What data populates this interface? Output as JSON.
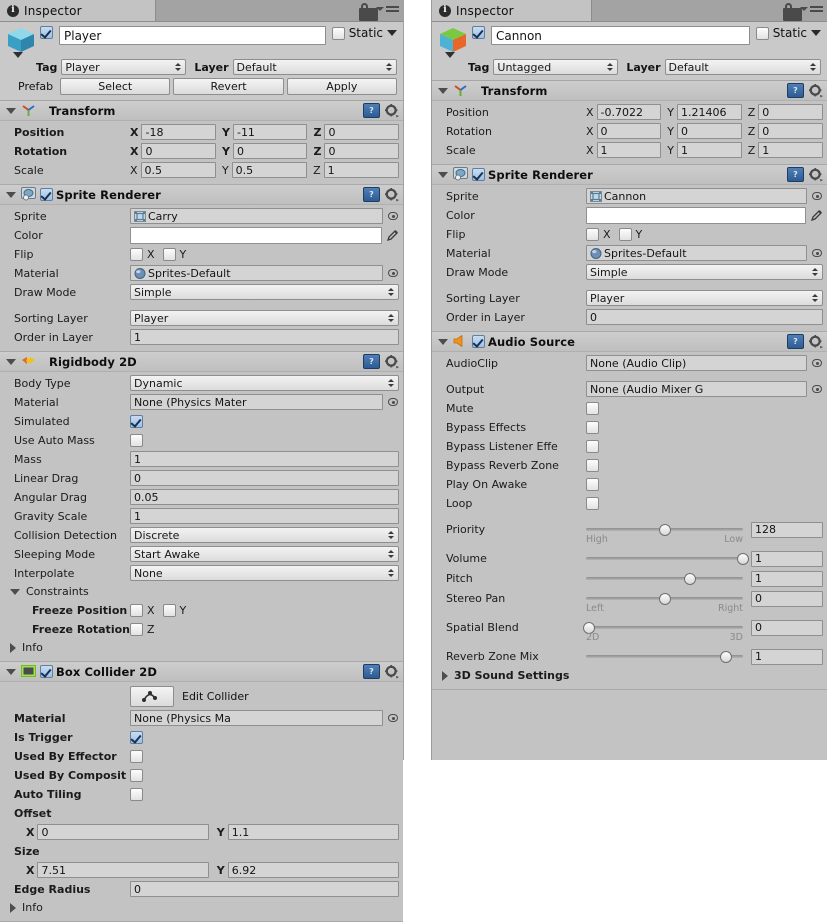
{
  "window": {
    "tab_label": "Inspector",
    "tab_icon": "info-icon",
    "lock_icon": "lock-icon",
    "menu_icon": "hamburger-menu-icon"
  },
  "left": {
    "header": {
      "enabled": true,
      "name": "Player",
      "static_label": "Static",
      "static_checked": false,
      "tag_label": "Tag",
      "tag_value": "Player",
      "layer_label": "Layer",
      "layer_value": "Default",
      "prefab_label": "Prefab",
      "prefab_buttons": [
        "Select",
        "Revert",
        "Apply"
      ]
    },
    "components": [
      {
        "title": "Transform",
        "icon": "transform-axis-icon",
        "has_checkbox": false,
        "expanded": true,
        "rows": [
          {
            "type": "vector3",
            "label": "Position",
            "bold": true,
            "x": "-18",
            "y": "-11",
            "z": "0"
          },
          {
            "type": "vector3",
            "label": "Rotation",
            "bold": true,
            "x": "0",
            "y": "0",
            "z": "0"
          },
          {
            "type": "vector3",
            "label": "Scale",
            "bold": false,
            "x": "0.5",
            "y": "0.5",
            "z": "1"
          }
        ]
      },
      {
        "title": "Sprite Renderer",
        "icon": "sprite-renderer-icon",
        "has_checkbox": true,
        "checked": true,
        "expanded": true,
        "rows": [
          {
            "type": "object",
            "label": "Sprite",
            "value": "Carry",
            "thumb": "sprite-thumb"
          },
          {
            "type": "color",
            "label": "Color",
            "value": "#ffffff"
          },
          {
            "type": "flip",
            "label": "Flip",
            "x_label": "X",
            "y_label": "Y",
            "x": false,
            "y": false
          },
          {
            "type": "object",
            "label": "Material",
            "value": "Sprites-Default",
            "thumb": "material-sphere"
          },
          {
            "type": "popup",
            "label": "Draw Mode",
            "value": "Simple"
          },
          {
            "type": "spacer"
          },
          {
            "type": "popup",
            "label": "Sorting Layer",
            "value": "Player"
          },
          {
            "type": "text",
            "label": "Order in Layer",
            "value": "1"
          }
        ]
      },
      {
        "title": "Rigidbody 2D",
        "icon": "rigidbody2d-icon",
        "has_checkbox": false,
        "expanded": true,
        "rows": [
          {
            "type": "popup",
            "label": "Body Type",
            "value": "Dynamic"
          },
          {
            "type": "object",
            "label": "Material",
            "value": "None (Physics Mater",
            "thumb": "none"
          },
          {
            "type": "check",
            "label": "Simulated",
            "checked": true
          },
          {
            "type": "check",
            "label": "Use Auto Mass",
            "checked": false
          },
          {
            "type": "text",
            "label": "Mass",
            "value": "1"
          },
          {
            "type": "text",
            "label": "Linear Drag",
            "value": "0"
          },
          {
            "type": "text",
            "label": "Angular Drag",
            "value": "0.05"
          },
          {
            "type": "text",
            "label": "Gravity Scale",
            "value": "1"
          },
          {
            "type": "popup",
            "label": "Collision Detection",
            "value": "Discrete"
          },
          {
            "type": "popup",
            "label": "Sleeping Mode",
            "value": "Start Awake"
          },
          {
            "type": "popup",
            "label": "Interpolate",
            "value": "None"
          },
          {
            "type": "foldout",
            "label": "Constraints",
            "open": true
          },
          {
            "type": "freeze",
            "label": "Freeze Position",
            "bold": true,
            "a_label": "X",
            "b_label": "Y",
            "a": false,
            "b": false
          },
          {
            "type": "freeze1",
            "label": "Freeze Rotation",
            "bold": true,
            "a_label": "Z",
            "a": false
          },
          {
            "type": "foldout",
            "label": "Info",
            "open": false
          }
        ]
      },
      {
        "title": "Box Collider 2D",
        "icon": "boxcollider2d-icon",
        "has_checkbox": true,
        "checked": true,
        "expanded": true,
        "rows": [
          {
            "type": "editcollider",
            "button_icon": "edit-collider-icon",
            "label": "Edit Collider"
          },
          {
            "type": "object",
            "label": "Material",
            "bold": true,
            "value": "None (Physics Ma",
            "thumb": "none"
          },
          {
            "type": "check",
            "label": "Is Trigger",
            "bold": true,
            "checked": true
          },
          {
            "type": "check",
            "label": "Used By Effector",
            "bold": true,
            "checked": false
          },
          {
            "type": "check",
            "label": "Used By Composit",
            "bold": true,
            "checked": false
          },
          {
            "type": "check",
            "label": "Auto Tiling",
            "bold": true,
            "checked": false
          },
          {
            "type": "vec2head",
            "label": "Offset",
            "bold": true
          },
          {
            "type": "vector2",
            "bold": true,
            "x": "0",
            "y": "1.1"
          },
          {
            "type": "vec2head",
            "label": "Size",
            "bold": true
          },
          {
            "type": "vector2",
            "bold": true,
            "x": "7.51",
            "y": "6.92"
          },
          {
            "type": "text",
            "label": "Edge Radius",
            "bold": true,
            "value": "0"
          },
          {
            "type": "foldout",
            "label": "Info",
            "open": false
          }
        ]
      }
    ]
  },
  "right": {
    "header": {
      "enabled": true,
      "name": "Cannon",
      "static_label": "Static",
      "static_checked": false,
      "tag_label": "Tag",
      "tag_value": "Untagged",
      "layer_label": "Layer",
      "layer_value": "Default"
    },
    "components": [
      {
        "title": "Transform",
        "icon": "transform-axis-icon",
        "has_checkbox": false,
        "expanded": true,
        "rows": [
          {
            "type": "vector3",
            "label": "Position",
            "bold": false,
            "x": "-0.7022",
            "y": "1.21406",
            "z": "0"
          },
          {
            "type": "vector3",
            "label": "Rotation",
            "bold": false,
            "x": "0",
            "y": "0",
            "z": "0"
          },
          {
            "type": "vector3",
            "label": "Scale",
            "bold": false,
            "x": "1",
            "y": "1",
            "z": "1"
          }
        ]
      },
      {
        "title": "Sprite Renderer",
        "icon": "sprite-renderer-icon",
        "has_checkbox": true,
        "checked": true,
        "expanded": true,
        "rows": [
          {
            "type": "object",
            "label": "Sprite",
            "value": "Cannon",
            "thumb": "sprite-thumb"
          },
          {
            "type": "color",
            "label": "Color",
            "value": "#ffffff"
          },
          {
            "type": "flip",
            "label": "Flip",
            "x_label": "X",
            "y_label": "Y",
            "x": false,
            "y": false
          },
          {
            "type": "object",
            "label": "Material",
            "value": "Sprites-Default",
            "thumb": "material-sphere"
          },
          {
            "type": "popup",
            "label": "Draw Mode",
            "value": "Simple"
          },
          {
            "type": "spacer"
          },
          {
            "type": "popup",
            "label": "Sorting Layer",
            "value": "Player"
          },
          {
            "type": "text",
            "label": "Order in Layer",
            "value": "0"
          }
        ]
      },
      {
        "title": "Audio Source",
        "icon": "audio-source-icon",
        "has_checkbox": true,
        "checked": true,
        "expanded": true,
        "rows": [
          {
            "type": "object",
            "label": "AudioClip",
            "value": "None (Audio Clip)",
            "thumb": "none"
          },
          {
            "type": "spacer"
          },
          {
            "type": "object",
            "label": "Output",
            "value": "None (Audio Mixer G",
            "thumb": "none"
          },
          {
            "type": "check",
            "label": "Mute",
            "checked": false
          },
          {
            "type": "check",
            "label": "Bypass Effects",
            "checked": false
          },
          {
            "type": "check",
            "label": "Bypass Listener Effe",
            "checked": false
          },
          {
            "type": "check",
            "label": "Bypass Reverb Zone",
            "checked": false
          },
          {
            "type": "check",
            "label": "Play On Awake",
            "checked": false
          },
          {
            "type": "check",
            "label": "Loop",
            "checked": false
          },
          {
            "type": "spacer"
          },
          {
            "type": "slider",
            "label": "Priority",
            "value": "128",
            "pct": 50,
            "min_label": "High",
            "max_label": "Low"
          },
          {
            "type": "slider",
            "label": "Volume",
            "value": "1",
            "pct": 100,
            "min_label": "",
            "max_label": ""
          },
          {
            "type": "slider",
            "label": "Pitch",
            "value": "1",
            "pct": 66,
            "min_label": "",
            "max_label": ""
          },
          {
            "type": "slider",
            "label": "Stereo Pan",
            "value": "0",
            "pct": 50,
            "min_label": "Left",
            "max_label": "Right"
          },
          {
            "type": "slider",
            "label": "Spatial Blend",
            "value": "0",
            "pct": 2,
            "min_label": "2D",
            "max_label": "3D"
          },
          {
            "type": "slider",
            "label": "Reverb Zone Mix",
            "value": "1",
            "pct": 89,
            "min_label": "",
            "max_label": ""
          },
          {
            "type": "foldout",
            "label": "3D Sound Settings",
            "open": false,
            "bold": true
          }
        ]
      }
    ]
  }
}
